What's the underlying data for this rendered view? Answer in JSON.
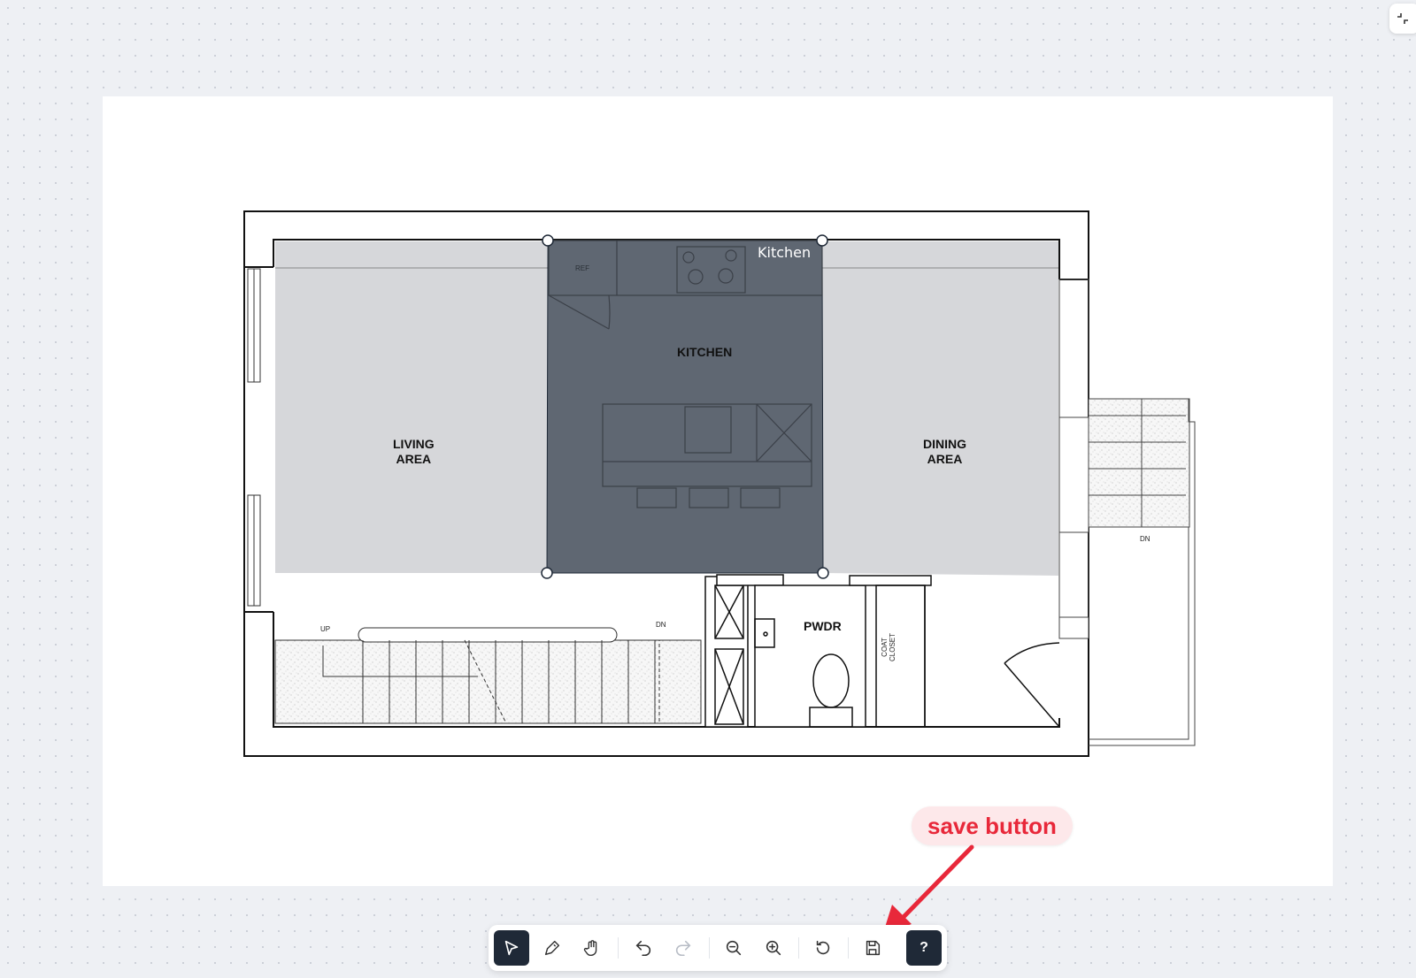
{
  "plan": {
    "rooms": {
      "kitchen": "KITCHEN",
      "living": "LIVING\nAREA",
      "dining": "DINING\nAREA",
      "powder": "PWDR",
      "coat_closet": "COAT\nCLOSET"
    },
    "labels": {
      "ref": "REF",
      "up": "UP",
      "dn_stairs": "DN",
      "dn_porch": "DN"
    },
    "selected_polygon_label": "Kitchen"
  },
  "annotation": {
    "callout_text": "save button"
  },
  "toolbar": {
    "tools": [
      {
        "icon": "pointer-icon",
        "active": true
      },
      {
        "icon": "pen-icon"
      },
      {
        "icon": "hand-icon"
      },
      {
        "icon": "undo-icon"
      },
      {
        "icon": "redo-icon",
        "disabled": true
      },
      {
        "icon": "zoom-out-icon"
      },
      {
        "icon": "zoom-in-icon"
      },
      {
        "icon": "reset-icon"
      },
      {
        "icon": "save-icon"
      }
    ],
    "help_label": "?"
  },
  "colors": {
    "kitchen_fill": "#5f6772",
    "room_fill": "#d6d7da",
    "callout_red": "#e8283a",
    "active_tool": "#1f2937"
  }
}
